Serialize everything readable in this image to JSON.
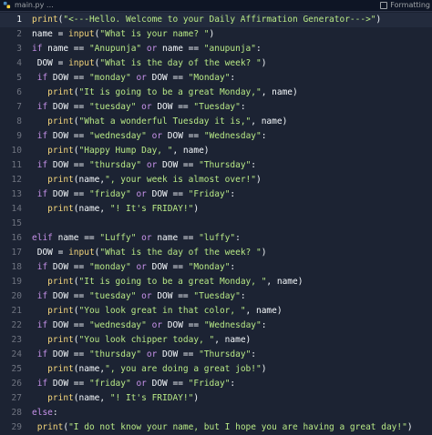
{
  "tab": {
    "filename": "main.py",
    "ellipsis": "…",
    "format_label": "Formatting"
  },
  "colors": {
    "background": "#1c2333",
    "keyword": "#c792ea",
    "function": "#f5d67b",
    "string": "#b8e986",
    "text": "#f5f9fc",
    "line_number": "#6f7480"
  },
  "editor": {
    "active_line": 1,
    "lines": [
      {
        "n": "1",
        "indent": "",
        "tokens": [
          [
            "fn",
            "print"
          ],
          [
            "op",
            "("
          ],
          [
            "str",
            "\"<---Hello. Welcome to your Daily Affirmation Generator--->\""
          ],
          [
            "op",
            ")"
          ]
        ]
      },
      {
        "n": "2",
        "indent": "",
        "tokens": [
          [
            "id",
            "name = "
          ],
          [
            "fn",
            "input"
          ],
          [
            "op",
            "("
          ],
          [
            "str",
            "\"What is your name? \""
          ],
          [
            "op",
            ")"
          ]
        ]
      },
      {
        "n": "3",
        "indent": "",
        "tokens": [
          [
            "kw",
            "if "
          ],
          [
            "id",
            "name == "
          ],
          [
            "str",
            "\"Anupunja\""
          ],
          [
            "kw",
            " or "
          ],
          [
            "id",
            "name == "
          ],
          [
            "str",
            "\"anupunja\""
          ],
          [
            "op",
            ":"
          ]
        ]
      },
      {
        "n": "4",
        "indent": " ",
        "tokens": [
          [
            "id",
            "DOW = "
          ],
          [
            "fn",
            "input"
          ],
          [
            "op",
            "("
          ],
          [
            "str",
            "\"What is the day of the week? \""
          ],
          [
            "op",
            ")"
          ]
        ]
      },
      {
        "n": "5",
        "indent": " ",
        "tokens": [
          [
            "kw",
            "if "
          ],
          [
            "id",
            "DOW == "
          ],
          [
            "str",
            "\"monday\""
          ],
          [
            "kw",
            " or "
          ],
          [
            "id",
            "DOW == "
          ],
          [
            "str",
            "\"Monday\""
          ],
          [
            "op",
            ":"
          ]
        ]
      },
      {
        "n": "6",
        "indent": "   ",
        "tokens": [
          [
            "fn",
            "print"
          ],
          [
            "op",
            "("
          ],
          [
            "str",
            "\"It is going to be a great Monday,\""
          ],
          [
            "op",
            ", name)"
          ]
        ]
      },
      {
        "n": "7",
        "indent": " ",
        "tokens": [
          [
            "kw",
            "if "
          ],
          [
            "id",
            "DOW == "
          ],
          [
            "str",
            "\"tuesday\""
          ],
          [
            "kw",
            " or "
          ],
          [
            "id",
            "DOW == "
          ],
          [
            "str",
            "\"Tuesday\""
          ],
          [
            "op",
            ":"
          ]
        ]
      },
      {
        "n": "8",
        "indent": "   ",
        "tokens": [
          [
            "fn",
            "print"
          ],
          [
            "op",
            "("
          ],
          [
            "str",
            "\"What a wonderful Tuesday it is,\""
          ],
          [
            "op",
            ", name)"
          ]
        ]
      },
      {
        "n": "9",
        "indent": " ",
        "tokens": [
          [
            "kw",
            "if "
          ],
          [
            "id",
            "DOW == "
          ],
          [
            "str",
            "\"wednesday\""
          ],
          [
            "kw",
            " or "
          ],
          [
            "id",
            "DOW == "
          ],
          [
            "str",
            "\"Wednesday\""
          ],
          [
            "op",
            ":"
          ]
        ]
      },
      {
        "n": "10",
        "indent": "   ",
        "tokens": [
          [
            "fn",
            "print"
          ],
          [
            "op",
            "("
          ],
          [
            "str",
            "\"Happy Hump Day, \""
          ],
          [
            "op",
            ", name)"
          ]
        ]
      },
      {
        "n": "11",
        "indent": " ",
        "tokens": [
          [
            "kw",
            "if "
          ],
          [
            "id",
            "DOW == "
          ],
          [
            "str",
            "\"thursday\""
          ],
          [
            "kw",
            " or "
          ],
          [
            "id",
            "DOW == "
          ],
          [
            "str",
            "\"Thursday\""
          ],
          [
            "op",
            ":"
          ]
        ]
      },
      {
        "n": "12",
        "indent": "   ",
        "tokens": [
          [
            "fn",
            "print"
          ],
          [
            "op",
            "(name,"
          ],
          [
            "str",
            "\", your week is almost over!\""
          ],
          [
            "op",
            ")"
          ]
        ]
      },
      {
        "n": "13",
        "indent": " ",
        "tokens": [
          [
            "kw",
            "if "
          ],
          [
            "id",
            "DOW == "
          ],
          [
            "str",
            "\"friday\""
          ],
          [
            "kw",
            " or "
          ],
          [
            "id",
            "DOW == "
          ],
          [
            "str",
            "\"Friday\""
          ],
          [
            "op",
            ":"
          ]
        ]
      },
      {
        "n": "14",
        "indent": "   ",
        "tokens": [
          [
            "fn",
            "print"
          ],
          [
            "op",
            "(name, "
          ],
          [
            "str",
            "\"! It's FRIDAY!\""
          ],
          [
            "op",
            ")"
          ]
        ]
      },
      {
        "n": "15",
        "indent": "",
        "tokens": []
      },
      {
        "n": "16",
        "indent": "",
        "tokens": [
          [
            "kw",
            "elif "
          ],
          [
            "id",
            "name == "
          ],
          [
            "str",
            "\"Luffy\""
          ],
          [
            "kw",
            " or "
          ],
          [
            "id",
            "name == "
          ],
          [
            "str",
            "\"luffy\""
          ],
          [
            "op",
            ":"
          ]
        ]
      },
      {
        "n": "17",
        "indent": " ",
        "tokens": [
          [
            "id",
            "DOW = "
          ],
          [
            "fn",
            "input"
          ],
          [
            "op",
            "("
          ],
          [
            "str",
            "\"What is the day of the week? \""
          ],
          [
            "op",
            ")"
          ]
        ]
      },
      {
        "n": "18",
        "indent": " ",
        "tokens": [
          [
            "kw",
            "if "
          ],
          [
            "id",
            "DOW == "
          ],
          [
            "str",
            "\"monday\""
          ],
          [
            "kw",
            " or "
          ],
          [
            "id",
            "DOW == "
          ],
          [
            "str",
            "\"Monday\""
          ],
          [
            "op",
            ":"
          ]
        ]
      },
      {
        "n": "19",
        "indent": "   ",
        "tokens": [
          [
            "fn",
            "print"
          ],
          [
            "op",
            "("
          ],
          [
            "str",
            "\"It is going to be a great Monday, \""
          ],
          [
            "op",
            ", name)"
          ]
        ]
      },
      {
        "n": "20",
        "indent": " ",
        "tokens": [
          [
            "kw",
            "if "
          ],
          [
            "id",
            "DOW == "
          ],
          [
            "str",
            "\"tuesday\""
          ],
          [
            "kw",
            " or "
          ],
          [
            "id",
            "DOW == "
          ],
          [
            "str",
            "\"Tuesday\""
          ],
          [
            "op",
            ":"
          ]
        ]
      },
      {
        "n": "21",
        "indent": "   ",
        "tokens": [
          [
            "fn",
            "print"
          ],
          [
            "op",
            "("
          ],
          [
            "str",
            "\"You look great in that color, \""
          ],
          [
            "op",
            ", name)"
          ]
        ]
      },
      {
        "n": "22",
        "indent": " ",
        "tokens": [
          [
            "kw",
            "if "
          ],
          [
            "id",
            "DOW == "
          ],
          [
            "str",
            "\"wednesday\""
          ],
          [
            "kw",
            " or "
          ],
          [
            "id",
            "DOW == "
          ],
          [
            "str",
            "\"Wednesday\""
          ],
          [
            "op",
            ":"
          ]
        ]
      },
      {
        "n": "23",
        "indent": "   ",
        "tokens": [
          [
            "fn",
            "print"
          ],
          [
            "op",
            "("
          ],
          [
            "str",
            "\"You look chipper today, \""
          ],
          [
            "op",
            ", name)"
          ]
        ]
      },
      {
        "n": "24",
        "indent": " ",
        "tokens": [
          [
            "kw",
            "if "
          ],
          [
            "id",
            "DOW == "
          ],
          [
            "str",
            "\"thursday\""
          ],
          [
            "kw",
            " or "
          ],
          [
            "id",
            "DOW == "
          ],
          [
            "str",
            "\"Thursday\""
          ],
          [
            "op",
            ":"
          ]
        ]
      },
      {
        "n": "25",
        "indent": "   ",
        "tokens": [
          [
            "fn",
            "print"
          ],
          [
            "op",
            "(name,"
          ],
          [
            "str",
            "\", you are doing a great job!\""
          ],
          [
            "op",
            ")"
          ]
        ]
      },
      {
        "n": "26",
        "indent": " ",
        "tokens": [
          [
            "kw",
            "if "
          ],
          [
            "id",
            "DOW == "
          ],
          [
            "str",
            "\"friday\""
          ],
          [
            "kw",
            " or "
          ],
          [
            "id",
            "DOW == "
          ],
          [
            "str",
            "\"Friday\""
          ],
          [
            "op",
            ":"
          ]
        ]
      },
      {
        "n": "27",
        "indent": "   ",
        "tokens": [
          [
            "fn",
            "print"
          ],
          [
            "op",
            "(name, "
          ],
          [
            "str",
            "\"! It's FRIDAY!\""
          ],
          [
            "op",
            ")"
          ]
        ]
      },
      {
        "n": "28",
        "indent": "",
        "tokens": [
          [
            "kw",
            "else"
          ],
          [
            "op",
            ":"
          ]
        ]
      },
      {
        "n": "29",
        "indent": " ",
        "tokens": [
          [
            "fn",
            "print"
          ],
          [
            "op",
            "("
          ],
          [
            "str",
            "\"I do not know your name, but I hope you are having a great day!\""
          ],
          [
            "op",
            ")"
          ]
        ]
      }
    ]
  }
}
